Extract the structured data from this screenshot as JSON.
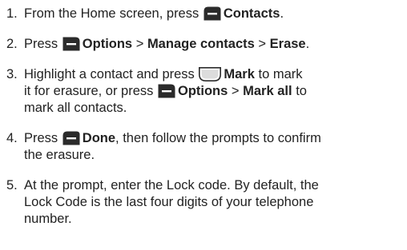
{
  "steps": [
    {
      "num": "1.",
      "pre": "From the Home screen, press",
      "b1": "Contacts",
      "post": "."
    },
    {
      "num": "2.",
      "pre": "Press",
      "b1": "Options",
      "sep1": ">",
      "b2": "Manage contacts",
      "sep2": ">",
      "b3": "Erase",
      "post": "."
    },
    {
      "num": "3.",
      "pre": "Highlight a contact and press",
      "b1": "Mark",
      "mid": "to mark",
      "line2_pre": "it for erasure, or press",
      "b2": "Options",
      "sep": ">",
      "b3": "Mark all",
      "line2_post": "to",
      "line3": "mark all contacts."
    },
    {
      "num": "4.",
      "pre": "Press",
      "b1": "Done",
      "post": ", then follow the prompts to confirm",
      "line2": "the erasure."
    },
    {
      "num": "5.",
      "line1": "At the prompt, enter the Lock code. By default, the",
      "line2": "Lock Code is the last four digits of your telephone",
      "line3": "number."
    }
  ],
  "icons": {
    "left_softkey": "left-softkey-icon",
    "center_key": "center-select-key-icon",
    "right_softkey": "right-softkey-icon"
  }
}
